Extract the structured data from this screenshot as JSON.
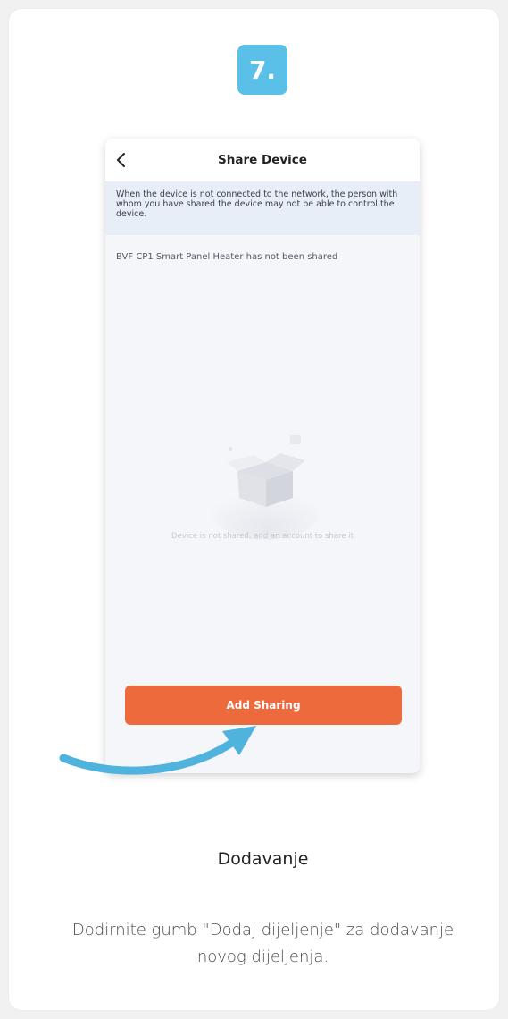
{
  "step": {
    "number": "7."
  },
  "screen": {
    "title": "Share Device",
    "notice": "When the device is not connected to the network, the person with whom you have shared the device may not be able to control the device.",
    "status": "BVF CP1 Smart Panel Heater has not been shared",
    "empty_text": "Device is not shared, add an account to share it",
    "button_label": "Add Sharing",
    "back_icon": "chevron-left-icon"
  },
  "instruction": {
    "title": "Dodavanje",
    "description": "Dodirnite gumb \"Dodaj dijeljenje\" za dodavanje novog dijeljenja."
  },
  "colors": {
    "badge": "#5bc0e8",
    "button": "#ec6a3c",
    "arrow": "#4fb3dd",
    "notice_bg": "#e8eef8"
  }
}
